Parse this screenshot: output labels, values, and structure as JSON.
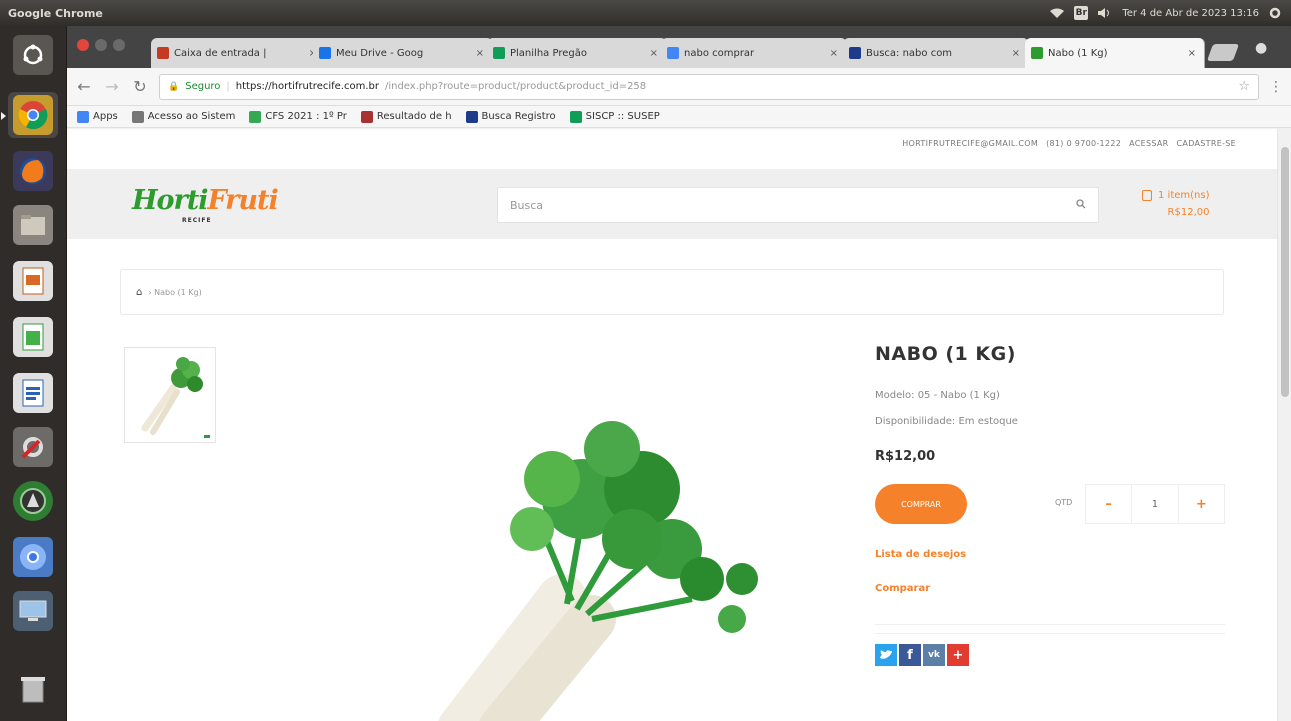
{
  "top_panel": {
    "app_title": "Google Chrome",
    "datetime": "Ter 4 de Abr de 2023 13:16"
  },
  "browser": {
    "tabs": [
      {
        "label": "Caixa de entrada |",
        "color": "#c23b22"
      },
      {
        "label": "Meu Drive - Goog",
        "color": "#1a73e8"
      },
      {
        "label": "Planilha Pregão",
        "color": "#0f9d58"
      },
      {
        "label": "nabo comprar",
        "color": "#4285f4"
      },
      {
        "label": "Busca: nabo com",
        "color": "#1e3a8a"
      },
      {
        "label": "Nabo (1 Kg)",
        "color": "#2e9b2e"
      }
    ],
    "url_secure": "Seguro",
    "url_host": "https://hortifrutrecife.com.br",
    "url_rest": "/index.php?route=product/product&product_id=258",
    "bookmarks": [
      {
        "label": "Apps",
        "color": "#4285f4"
      },
      {
        "label": "Acesso ao Sistem",
        "color": "#777777"
      },
      {
        "label": "CFS 2021 : 1º Pr",
        "color": "#34a853"
      },
      {
        "label": "Resultado de h",
        "color": "#a83232"
      },
      {
        "label": "Busca Registro",
        "color": "#1e3a8a"
      },
      {
        "label": "SISCP :: SUSEP",
        "color": "#0f9d58"
      }
    ]
  },
  "site": {
    "topinfo": {
      "email": "HORTIFRUTRECIFE@GMAIL.COM",
      "phone": "(81) 0 9700-1222",
      "login": "ACESSAR",
      "register": "CADASTRE-SE"
    },
    "logo": {
      "main_a": "Horti",
      "main_b": "Fruti",
      "sub": "RECIFE"
    },
    "search_placeholder": "Busca",
    "cart": {
      "label": "1 item(ns)",
      "total": "R$12,00"
    },
    "breadcrumb": "› Nabo (1 Kg)",
    "product": {
      "title": "NABO (1 KG)",
      "model": "Modelo: 05 - Nabo (1 Kg)",
      "availability": "Disponibilidade: Em estoque",
      "price": "R$12,00",
      "buy_label": "COMPRAR",
      "qty_label": "QTD",
      "qty_value": "1",
      "wishlist": "Lista de desejos",
      "compare": "Comparar"
    }
  }
}
